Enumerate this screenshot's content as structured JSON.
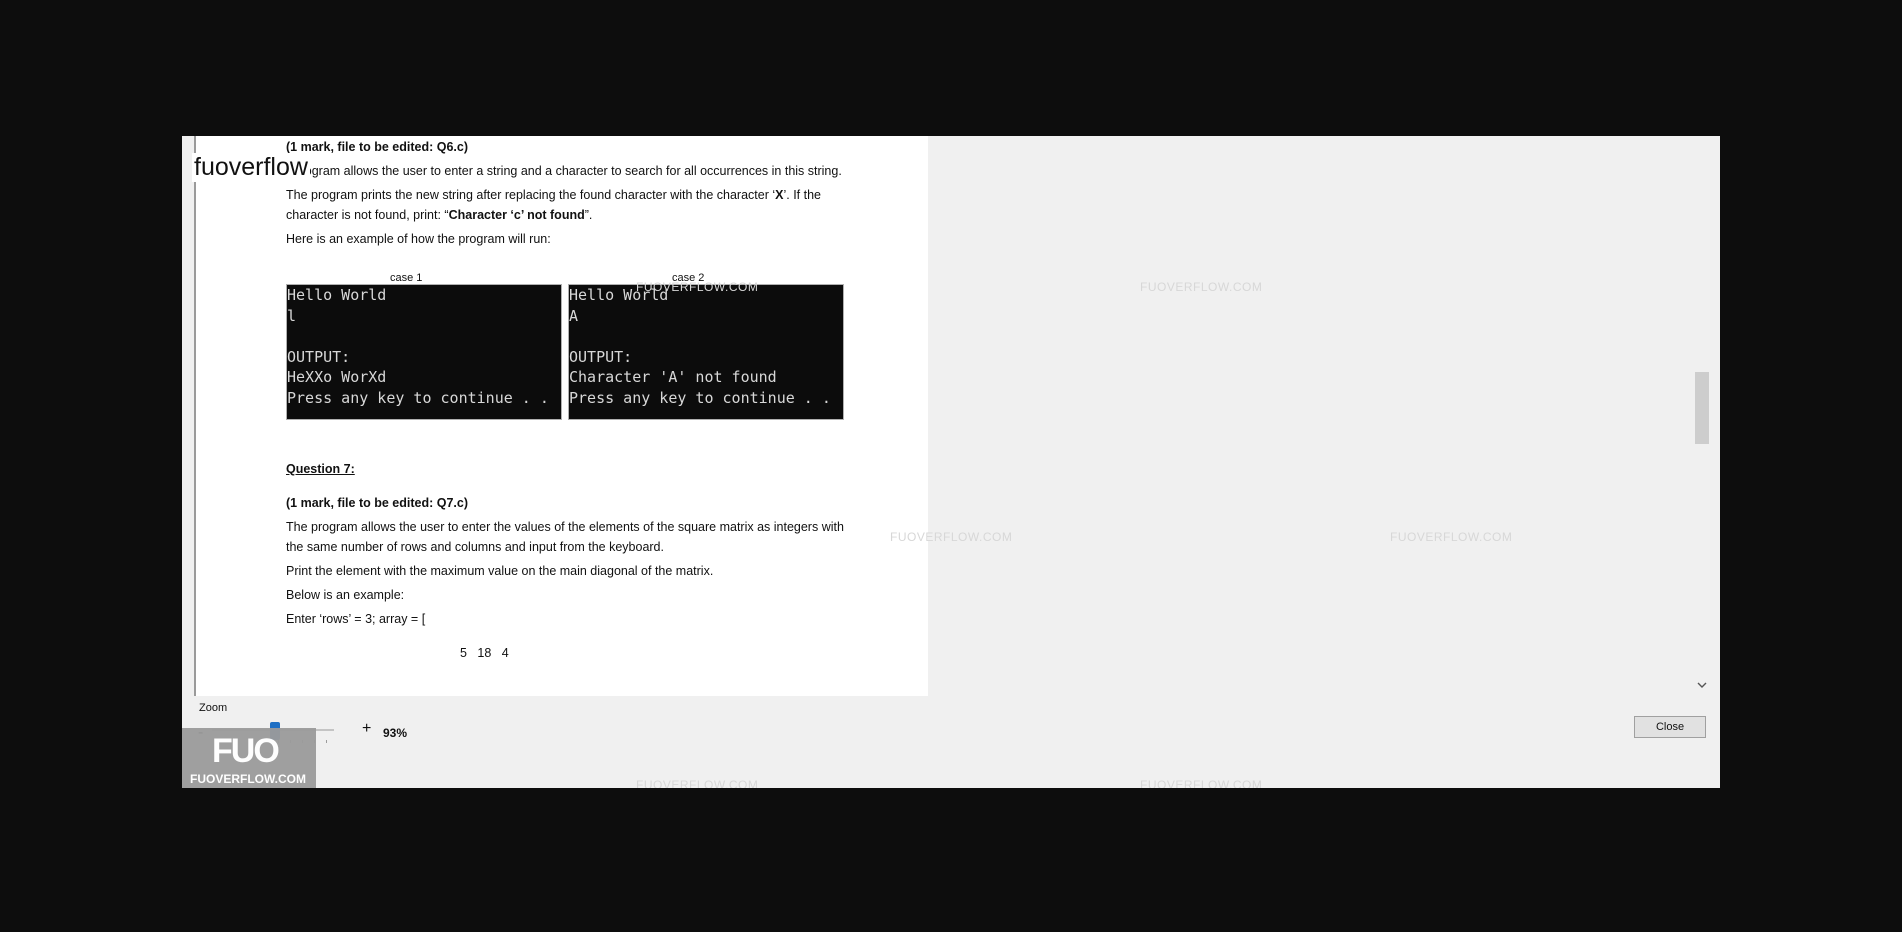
{
  "logo": {
    "text": "fuoverflow"
  },
  "document": {
    "q6_mark": "(1 mark, file to be edited: Q6.c)",
    "q6_line1": "· program allows the user to enter a string and a character to search for all occurrences in this string.",
    "q6_line2a": "The program prints the new string after replacing the found character with the character ‘",
    "q6_line2b": "X",
    "q6_line2c": "’. If the",
    "q6_line3a": "character is not found, print: “",
    "q6_line3b": "Character ‘c’ not found",
    "q6_line3c": "”.",
    "q6_line4": "Here is an example of how the program will run:",
    "case1_caption": "case 1",
    "case2_caption": "case 2",
    "case1_lines": [
      "Hello World",
      "l",
      "",
      "OUTPUT:",
      "HeXXo WorXd",
      "Press any key to continue . . ."
    ],
    "case2_lines": [
      "Hello World",
      "A",
      "",
      "OUTPUT:",
      "Character 'A' not found",
      "Press any key to continue . . ."
    ],
    "q7_title": "Question 7:",
    "q7_mark": "(1 mark, file to be edited: Q7.c)",
    "q7_line1": "The program allows the user to enter the values of the elements of the square matrix as integers with",
    "q7_line2": "the same number of rows and columns and input from the keyboard.",
    "q7_line3": "Print the element with the maximum value on the main diagonal of the matrix.",
    "q7_line4": "Below is an example:",
    "q7_line5": "Enter ‘rows’ = 3; array = [",
    "q7_matrix_row": "5   18   4"
  },
  "watermarks": [
    "FUOVERFLOW.COM",
    "FUOVERFLOW.COM",
    "FUOVERFLOW.COM",
    "FUOVERFLOW.COM",
    "FUOVERFLOW.COM",
    "FUOVERFLOW.COM"
  ],
  "zoom": {
    "label": "Zoom",
    "minus": "-",
    "plus": "+",
    "value": "93%",
    "level_fraction": 0.52
  },
  "close_label": "Close",
  "badge": {
    "big": "FUO",
    "small": "FUOVERFLOW.COM"
  },
  "scroll_down_icon": "chevron-down-icon"
}
